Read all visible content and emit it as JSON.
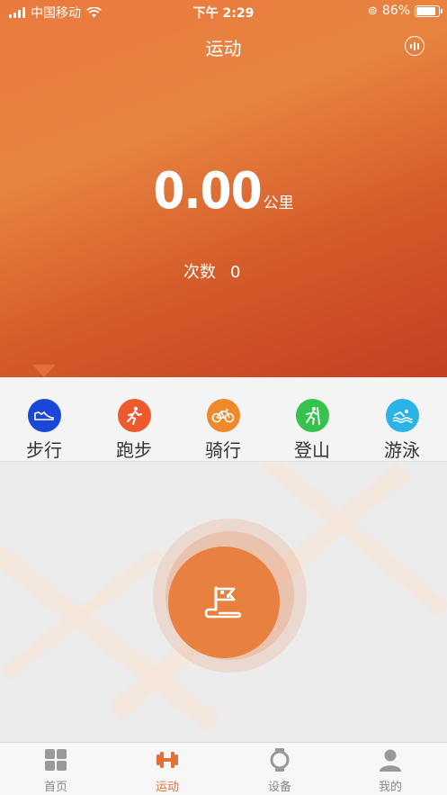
{
  "status_bar": {
    "carrier": "中国移动",
    "time": "下午 2:29",
    "battery_percent": "86%",
    "battery_level": 0.86
  },
  "header": {
    "title": "运动",
    "stats_icon": "bar-chart-icon"
  },
  "summary": {
    "distance_value": "0.00",
    "distance_unit": "公里",
    "count_label": "次数",
    "count_value": "0"
  },
  "activities": [
    {
      "label": "步行",
      "icon": "shoe-icon",
      "color": "#1b47d9",
      "selected": true
    },
    {
      "label": "跑步",
      "icon": "running-icon",
      "color": "#ec5a2e",
      "selected": false
    },
    {
      "label": "骑行",
      "icon": "bicycle-icon",
      "color": "#ef8a2c",
      "selected": false
    },
    {
      "label": "登山",
      "icon": "climbing-icon",
      "color": "#37c24f",
      "selected": false
    },
    {
      "label": "游泳",
      "icon": "swimming-icon",
      "color": "#2bb2e6",
      "selected": false
    }
  ],
  "start_button": {
    "icon": "flag-icon",
    "color": "#e8803f"
  },
  "tabs": [
    {
      "label": "首页",
      "icon": "grid-icon",
      "active": false
    },
    {
      "label": "运动",
      "icon": "dumbbell-icon",
      "active": true
    },
    {
      "label": "设备",
      "icon": "watch-icon",
      "active": false
    },
    {
      "label": "我的",
      "icon": "person-icon",
      "active": false
    }
  ],
  "colors": {
    "accent": "#e27038",
    "tab_inactive": "#888888"
  }
}
